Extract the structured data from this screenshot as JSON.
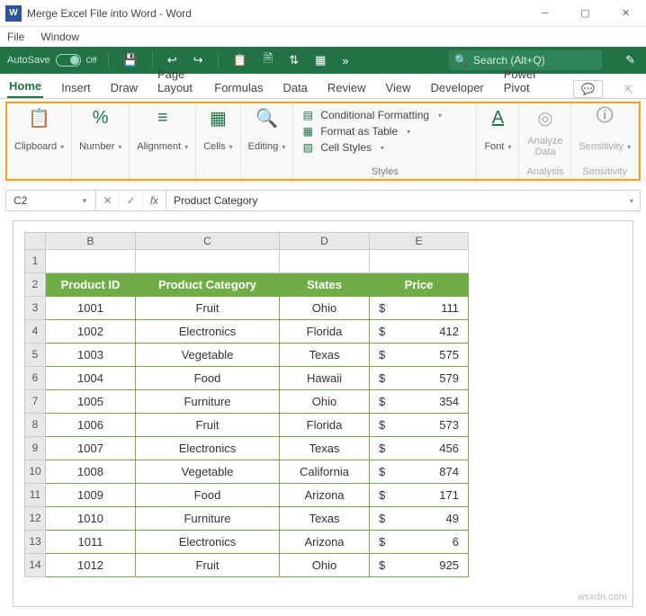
{
  "titlebar": {
    "title": "Merge Excel File into Word - Word"
  },
  "wordmenu": {
    "file": "File",
    "window": "Window"
  },
  "greenbar": {
    "autosave": "AutoSave",
    "autosave_state": "Off",
    "search_placeholder": "Search (Alt+Q)"
  },
  "tabs": {
    "items": [
      "Home",
      "Insert",
      "Draw",
      "Page Layout",
      "Formulas",
      "Data",
      "Review",
      "View",
      "Developer",
      "Power Pivot"
    ],
    "active": "Home"
  },
  "ribbon": {
    "clipboard": "Clipboard",
    "number": "Number",
    "alignment": "Alignment",
    "cells": "Cells",
    "editing": "Editing",
    "styles": {
      "conditional": "Conditional Formatting",
      "table": "Format as Table",
      "cellstyles": "Cell Styles",
      "label": "Styles"
    },
    "font": "Font",
    "analyze": {
      "line1": "Analyze",
      "line2": "Data",
      "label": "Analysis"
    },
    "sensitivity": {
      "line1": "Sensitivity",
      "label": "Sensitivity"
    }
  },
  "formulabar": {
    "cellref": "C2",
    "fx": "fx",
    "value": "Product Category"
  },
  "sheet": {
    "cols": [
      "B",
      "C",
      "D",
      "E"
    ],
    "header": {
      "b": "Product ID",
      "c": "Product Category",
      "d": "States",
      "e": "Price"
    },
    "rows": [
      {
        "n": "3",
        "b": "1001",
        "c": "Fruit",
        "d": "Ohio",
        "cur": "$",
        "e": "111"
      },
      {
        "n": "4",
        "b": "1002",
        "c": "Electronics",
        "d": "Florida",
        "cur": "$",
        "e": "412"
      },
      {
        "n": "5",
        "b": "1003",
        "c": "Vegetable",
        "d": "Texas",
        "cur": "$",
        "e": "575"
      },
      {
        "n": "6",
        "b": "1004",
        "c": "Food",
        "d": "Hawaii",
        "cur": "$",
        "e": "579"
      },
      {
        "n": "7",
        "b": "1005",
        "c": "Furniture",
        "d": "Ohio",
        "cur": "$",
        "e": "354"
      },
      {
        "n": "8",
        "b": "1006",
        "c": "Fruit",
        "d": "Florida",
        "cur": "$",
        "e": "573"
      },
      {
        "n": "9",
        "b": "1007",
        "c": "Electronics",
        "d": "Texas",
        "cur": "$",
        "e": "456"
      },
      {
        "n": "10",
        "b": "1008",
        "c": "Vegetable",
        "d": "California",
        "cur": "$",
        "e": "874"
      },
      {
        "n": "11",
        "b": "1009",
        "c": "Food",
        "d": "Arizona",
        "cur": "$",
        "e": "171"
      },
      {
        "n": "12",
        "b": "1010",
        "c": "Furniture",
        "d": "Texas",
        "cur": "$",
        "e": "49"
      },
      {
        "n": "13",
        "b": "1011",
        "c": "Electronics",
        "d": "Arizona",
        "cur": "$",
        "e": "6"
      },
      {
        "n": "14",
        "b": "1012",
        "c": "Fruit",
        "d": "Ohio",
        "cur": "$",
        "e": "925"
      }
    ]
  },
  "watermark": "wsxdn.com"
}
